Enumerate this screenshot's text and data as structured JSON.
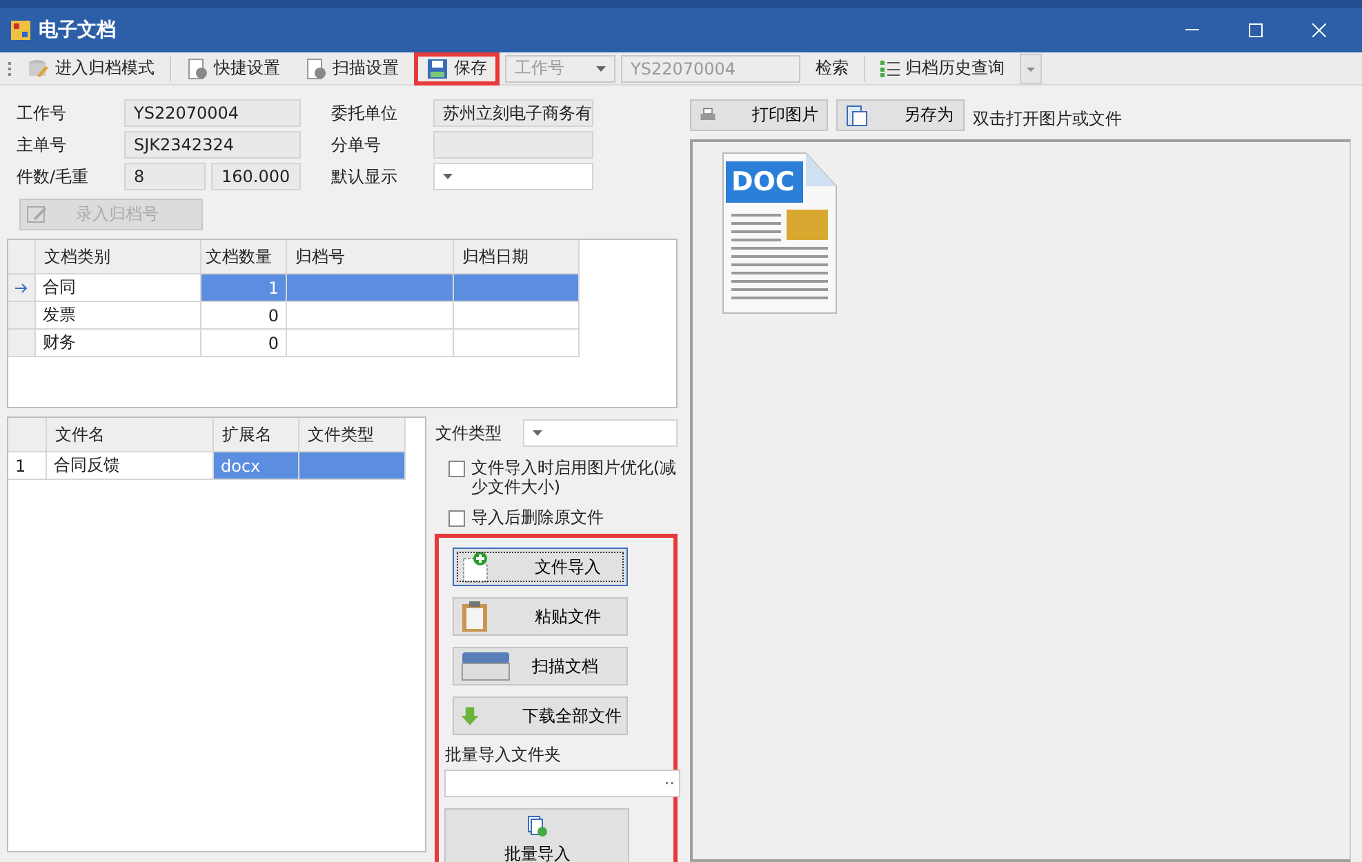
{
  "window": {
    "title": "电子文档"
  },
  "toolbar": [
    {
      "kind": "button",
      "label": "进入归档模式",
      "highlighted": false
    },
    {
      "kind": "button",
      "label": "快捷设置",
      "highlighted": false
    },
    {
      "kind": "button",
      "label": "扫描设置",
      "highlighted": false
    },
    {
      "kind": "button",
      "label": "保存",
      "highlighted": true
    },
    {
      "kind": "combo",
      "label": "工作号"
    },
    {
      "kind": "field",
      "label": "YS22070004"
    },
    {
      "kind": "link",
      "label": "检索"
    },
    {
      "kind": "button",
      "label": "归档历史查询",
      "highlighted": false
    },
    {
      "kind": "dropdown"
    }
  ],
  "form": {
    "rows": [
      {
        "label": "工作号",
        "fields": [
          {
            "kind": "field",
            "value": "YS22070004"
          }
        ],
        "label2": "委托单位",
        "fields2": [
          {
            "kind": "field",
            "value": "苏州立刻电子商务有"
          }
        ]
      },
      {
        "label": "主单号",
        "fields": [
          {
            "kind": "field",
            "value": "SJK2342324"
          }
        ],
        "label2": "分单号",
        "fields2": [
          {
            "kind": "field"
          }
        ]
      },
      {
        "label": "件数/毛重",
        "fields": [
          {
            "kind": "field",
            "value": "8"
          },
          {
            "kind": "field",
            "value": "160.000"
          }
        ],
        "label2": "默认显示",
        "fields2": [
          {
            "kind": "combo"
          }
        ]
      }
    ],
    "enter_button": {
      "label": "录入归档号",
      "disabled": true
    }
  },
  "doc_table": {
    "columns": [
      "文档类别",
      "文档数量",
      "归档号",
      "归档日期"
    ],
    "rows": [
      {
        "cells": [
          "合同",
          "1",
          "",
          ""
        ],
        "selected": true
      },
      {
        "cells": [
          "发票",
          "0",
          "",
          ""
        ],
        "selected": false
      },
      {
        "cells": [
          "财务",
          "0",
          "",
          ""
        ],
        "selected": false
      }
    ]
  },
  "file_table": {
    "columns": [
      "文件名",
      "扩展名",
      "文件类型"
    ],
    "rows": [
      {
        "number": "1",
        "cells": [
          "合同反馈",
          "docx",
          ""
        ],
        "selected": true
      }
    ]
  },
  "file_type": {
    "label": "文件类型"
  },
  "options": [
    {
      "label": "文件导入时启用图片优化(减少文件大小)",
      "checked": false
    },
    {
      "label": "导入后删除原文件",
      "checked": false
    }
  ],
  "actions": [
    {
      "label": "文件导入",
      "focused": true
    },
    {
      "label": "粘贴文件",
      "focused": false
    },
    {
      "label": "扫描文档",
      "focused": false
    },
    {
      "label": "下载全部文件",
      "focused": false
    }
  ],
  "batch": {
    "label": "批量导入文件夹",
    "browse": "··",
    "button": "批量导入"
  },
  "preview": {
    "buttons": [
      "打印图片",
      "另存为"
    ],
    "hint": "双击打开图片或文件",
    "files": [
      {
        "badge": "DOC"
      }
    ]
  }
}
